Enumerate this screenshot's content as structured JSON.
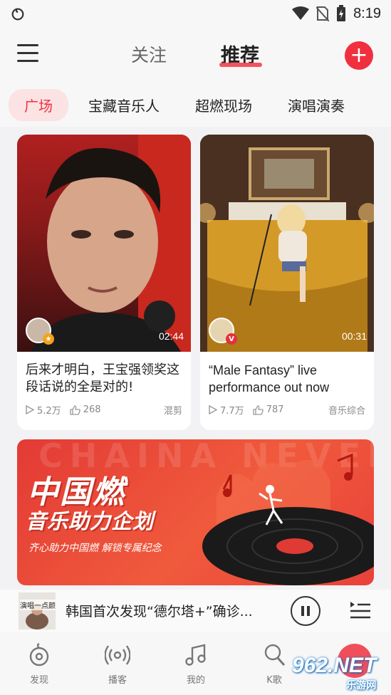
{
  "status_bar": {
    "time": "8:19"
  },
  "header": {
    "tabs": [
      {
        "label": "关注",
        "active": false
      },
      {
        "label": "推荐",
        "active": true
      }
    ]
  },
  "categories": [
    {
      "label": "广场",
      "active": true
    },
    {
      "label": "宝藏音乐人",
      "active": false
    },
    {
      "label": "超燃现场",
      "active": false
    },
    {
      "label": "演唱演奏",
      "active": false
    }
  ],
  "cards": [
    {
      "title": "后来才明白，王宝强领奖这段话说的全是对的!",
      "duration": "02:44",
      "plays": "5.2万",
      "likes": "268",
      "tag": "混剪"
    },
    {
      "title": "“Male Fantasy” live performance out now",
      "duration": "00:31",
      "plays": "7.7万",
      "likes": "787",
      "tag": "音乐综合"
    }
  ],
  "banner": {
    "background_text": "CHAINA NEVER DIE",
    "title": "中国燃",
    "subtitle": "音乐助力企划",
    "caption": "齐心助力中国燃 解锁专属纪念"
  },
  "player": {
    "cover_label": "演唱一点颜",
    "song": "韩国首次发现“德尔塔+”确诊..."
  },
  "bottom_nav": [
    {
      "label": "发现",
      "icon": "discover-icon"
    },
    {
      "label": "播客",
      "icon": "podcast-icon"
    },
    {
      "label": "我的",
      "icon": "music-note-icon"
    },
    {
      "label": "K歌",
      "icon": "microphone-icon"
    }
  ],
  "watermark": {
    "brand": "962.NET",
    "sub": "乐游网"
  },
  "colors": {
    "accent": "#f0303f",
    "background": "#f2f2f4"
  }
}
